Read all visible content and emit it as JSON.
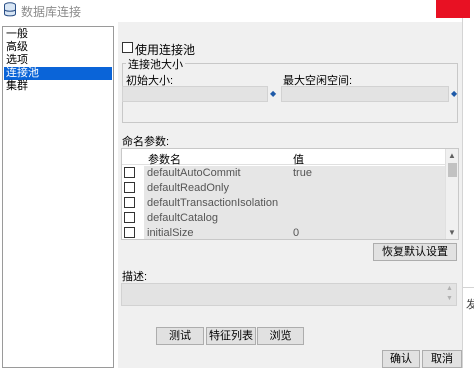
{
  "window": {
    "title": "数据库连接"
  },
  "nav": {
    "items": [
      "一般",
      "高级",
      "选项",
      "连接池",
      "集群"
    ],
    "selected": "连接池"
  },
  "pool": {
    "use_pool_label": "使用连接池",
    "group_title": "连接池大小",
    "initial_size_label": "初始大小:",
    "max_idle_label": "最大空闲空间:",
    "initial_size_value": "",
    "max_idle_value": ""
  },
  "params": {
    "label": "命名参数:",
    "col_name": "参数名",
    "col_value": "值",
    "rows": [
      {
        "name": "defaultAutoCommit",
        "value": "true"
      },
      {
        "name": "defaultReadOnly",
        "value": ""
      },
      {
        "name": "defaultTransactionIsolation",
        "value": ""
      },
      {
        "name": "defaultCatalog",
        "value": ""
      },
      {
        "name": "initialSize",
        "value": "0"
      }
    ],
    "restore_default_label": "恢复默认设置"
  },
  "description": {
    "label": "描述:",
    "value": ""
  },
  "buttons": {
    "test": "测试",
    "feature_list": "特征列表",
    "browse": "浏览",
    "ok": "确认",
    "cancel": "取消"
  },
  "background": {
    "glyph": "发"
  },
  "colors": {
    "selection": "#0a64d8",
    "close": "#e81123",
    "accent_icon": "#1e5aa8"
  }
}
